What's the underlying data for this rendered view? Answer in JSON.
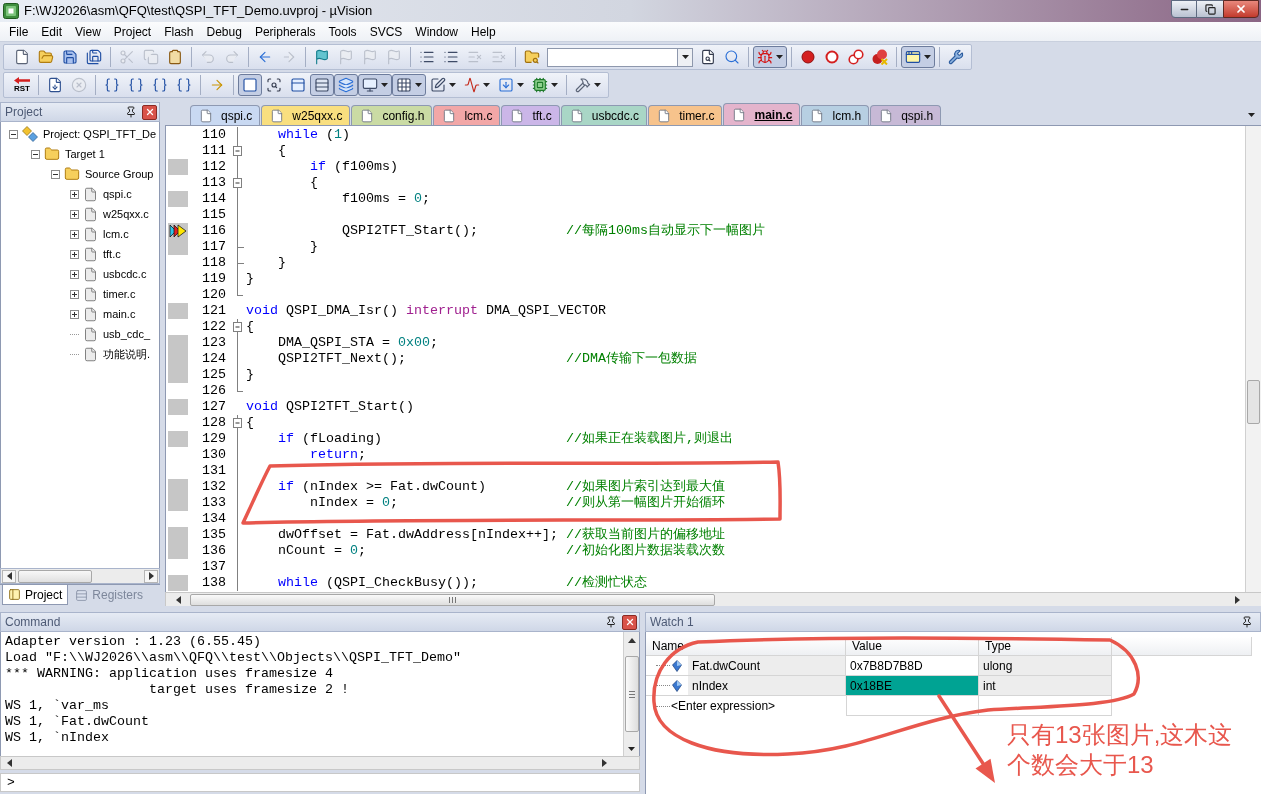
{
  "window": {
    "title": "F:\\WJ2026\\asm\\QFQ\\test\\QSPI_TFT_Demo.uvproj - µVision"
  },
  "menu": [
    "File",
    "Edit",
    "View",
    "Project",
    "Flash",
    "Debug",
    "Peripherals",
    "Tools",
    "SVCS",
    "Window",
    "Help"
  ],
  "toolbar_1": [
    {
      "kind": "button",
      "disabled": false,
      "pressed": false
    },
    {
      "kind": "button",
      "disabled": false,
      "pressed": false
    },
    {
      "kind": "button",
      "disabled": false,
      "pressed": false
    },
    {
      "kind": "button",
      "disabled": false,
      "pressed": false
    },
    {
      "kind": "separator"
    },
    {
      "kind": "button",
      "disabled": true,
      "pressed": false
    },
    {
      "kind": "button",
      "disabled": true,
      "pressed": false
    },
    {
      "kind": "button",
      "disabled": false,
      "pressed": false
    },
    {
      "kind": "separator"
    },
    {
      "kind": "button",
      "disabled": true,
      "pressed": false
    },
    {
      "kind": "button",
      "disabled": true,
      "pressed": false
    },
    {
      "kind": "separator"
    },
    {
      "kind": "button",
      "disabled": false,
      "pressed": false
    },
    {
      "kind": "button",
      "disabled": true,
      "pressed": false
    },
    {
      "kind": "separator"
    },
    {
      "kind": "button",
      "disabled": false,
      "pressed": false
    },
    {
      "kind": "button",
      "disabled": true,
      "pressed": false
    },
    {
      "kind": "button",
      "disabled": true,
      "pressed": false
    },
    {
      "kind": "button",
      "disabled": true,
      "pressed": false
    },
    {
      "kind": "separator"
    },
    {
      "kind": "button",
      "disabled": false,
      "pressed": false
    },
    {
      "kind": "button",
      "disabled": false,
      "pressed": false
    },
    {
      "kind": "button",
      "disabled": true,
      "pressed": false
    },
    {
      "kind": "button",
      "disabled": true,
      "pressed": false
    },
    {
      "kind": "separator"
    },
    {
      "kind": "button",
      "disabled": false,
      "pressed": false
    },
    {
      "kind": "combo"
    },
    {
      "kind": "button",
      "disabled": false,
      "pressed": false
    },
    {
      "kind": "button",
      "disabled": false,
      "pressed": false
    },
    {
      "kind": "separator"
    },
    {
      "kind": "button",
      "disabled": false,
      "pressed": true,
      "dropdown": true
    },
    {
      "kind": "separator"
    },
    {
      "kind": "button",
      "disabled": false,
      "pressed": false
    },
    {
      "kind": "button",
      "disabled": false,
      "pressed": false
    },
    {
      "kind": "button",
      "disabled": false,
      "pressed": false
    },
    {
      "kind": "button",
      "disabled": false,
      "pressed": false
    },
    {
      "kind": "separator"
    },
    {
      "kind": "button",
      "disabled": false,
      "pressed": true,
      "dropdown": true
    },
    {
      "kind": "separator"
    },
    {
      "kind": "button",
      "disabled": false,
      "pressed": false
    }
  ],
  "toolbar_2": [
    {
      "kind": "button",
      "label": "RST",
      "disabled": false,
      "pressed": false
    },
    {
      "kind": "separator"
    },
    {
      "kind": "button",
      "disabled": false,
      "pressed": false
    },
    {
      "kind": "button",
      "disabled": true,
      "pressed": false
    },
    {
      "kind": "separator"
    },
    {
      "kind": "button",
      "disabled": false,
      "pressed": false
    },
    {
      "kind": "button",
      "disabled": false,
      "pressed": false
    },
    {
      "kind": "button",
      "disabled": false,
      "pressed": false
    },
    {
      "kind": "button",
      "disabled": false,
      "pressed": false
    },
    {
      "kind": "separator"
    },
    {
      "kind": "button",
      "disabled": false,
      "pressed": false
    },
    {
      "kind": "separator"
    },
    {
      "kind": "button",
      "disabled": false,
      "pressed": true
    },
    {
      "kind": "button",
      "disabled": false,
      "pressed": false
    },
    {
      "kind": "button",
      "disabled": false,
      "pressed": false
    },
    {
      "kind": "button",
      "disabled": false,
      "pressed": true
    },
    {
      "kind": "button",
      "disabled": false,
      "pressed": true
    },
    {
      "kind": "button",
      "disabled": false,
      "pressed": true,
      "dropdown": true
    },
    {
      "kind": "button",
      "disabled": false,
      "pressed": true,
      "dropdown": true
    },
    {
      "kind": "button",
      "disabled": false,
      "pressed": false,
      "dropdown": true
    },
    {
      "kind": "button",
      "disabled": false,
      "pressed": false,
      "dropdown": true
    },
    {
      "kind": "button",
      "disabled": false,
      "pressed": false,
      "dropdown": true
    },
    {
      "kind": "button",
      "disabled": false,
      "pressed": false,
      "dropdown": true
    },
    {
      "kind": "separator"
    },
    {
      "kind": "button",
      "disabled": false,
      "pressed": false,
      "dropdown": true
    }
  ],
  "project_panel": {
    "title": "Project",
    "tree": [
      {
        "label": "Project: QSPI_TFT_De",
        "expanded": true,
        "children": [
          {
            "label": "Target 1",
            "expanded": true,
            "children": [
              {
                "label": "Source Group",
                "expanded": true,
                "children": [
                  {
                    "label": "qspi.c",
                    "expanded": false
                  },
                  {
                    "label": "w25qxx.c",
                    "expanded": false
                  },
                  {
                    "label": "lcm.c",
                    "expanded": false
                  },
                  {
                    "label": "tft.c",
                    "expanded": false
                  },
                  {
                    "label": "usbcdc.c",
                    "expanded": false
                  },
                  {
                    "label": "timer.c",
                    "expanded": false
                  },
                  {
                    "label": "main.c",
                    "expanded": false
                  },
                  {
                    "label": "usb_cdc_"
                  },
                  {
                    "label": "功能说明."
                  }
                ]
              }
            ]
          }
        ]
      }
    ],
    "tabs": [
      {
        "label": "Project",
        "selected": true
      },
      {
        "label": "Registers",
        "selected": false
      }
    ]
  },
  "editor": {
    "tabs": [
      {
        "label": "qspi.c",
        "color": "#c9d9f2",
        "selected": false
      },
      {
        "label": "w25qxx.c",
        "color": "#f9df7f",
        "selected": false
      },
      {
        "label": "config.h",
        "color": "#cadba4",
        "selected": false
      },
      {
        "label": "lcm.c",
        "color": "#f2a7a7",
        "selected": false
      },
      {
        "label": "tft.c",
        "color": "#cbb6e8",
        "selected": false
      },
      {
        "label": "usbcdc.c",
        "color": "#a9d6c6",
        "selected": false
      },
      {
        "label": "timer.c",
        "color": "#f7c38c",
        "selected": false
      },
      {
        "label": "main.c",
        "color": "#e4b4cc",
        "selected": true
      },
      {
        "label": "lcm.h",
        "color": "#b7cfe2",
        "selected": false
      },
      {
        "label": "qspi.h",
        "color": "#c7b9d6",
        "selected": false
      }
    ],
    "lines": [
      {
        "number": "110",
        "kind": "bar",
        "executable": false,
        "current": false,
        "tokens": [
          {
            "kind": "keyword",
            "text": "    while"
          },
          {
            "kind": "plain",
            "text": " ("
          },
          {
            "kind": "number",
            "text": "1"
          },
          {
            "kind": "plain",
            "text": ")"
          }
        ]
      },
      {
        "number": "111",
        "kind": "open",
        "executable": false,
        "current": false,
        "tokens": [
          {
            "kind": "plain",
            "text": "    {"
          }
        ]
      },
      {
        "number": "112",
        "kind": "bar",
        "executable": true,
        "current": false,
        "tokens": [
          {
            "kind": "keyword",
            "text": "        if"
          },
          {
            "kind": "plain",
            "text": " (f100ms)"
          }
        ]
      },
      {
        "number": "113",
        "kind": "open",
        "executable": false,
        "current": false,
        "tokens": [
          {
            "kind": "plain",
            "text": "        {"
          }
        ]
      },
      {
        "number": "114",
        "kind": "bar",
        "executable": true,
        "current": false,
        "tokens": [
          {
            "kind": "plain",
            "text": "            f100ms = "
          },
          {
            "kind": "number",
            "text": "0"
          },
          {
            "kind": "plain",
            "text": ";"
          }
        ]
      },
      {
        "number": "115",
        "kind": "bar",
        "executable": false,
        "current": false
      },
      {
        "number": "116",
        "kind": "bar",
        "executable": true,
        "current": true,
        "tokens": [
          {
            "kind": "plain",
            "text": "            QSPI2TFT_Start();           "
          },
          {
            "kind": "comment",
            "text": "//每隔100ms自动显示下一幅图片"
          }
        ]
      },
      {
        "number": "117",
        "kind": "tee",
        "executable": true,
        "current": false,
        "tokens": [
          {
            "kind": "plain",
            "text": "        }"
          }
        ]
      },
      {
        "number": "118",
        "kind": "tee",
        "executable": false,
        "current": false,
        "tokens": [
          {
            "kind": "plain",
            "text": "    }"
          }
        ]
      },
      {
        "number": "119",
        "kind": "bar",
        "executable": false,
        "current": false,
        "tokens": [
          {
            "kind": "plain",
            "text": "}"
          }
        ]
      },
      {
        "number": "120",
        "kind": "end",
        "executable": false,
        "current": false
      },
      {
        "number": "121",
        "kind": "plain",
        "executable": true,
        "current": false,
        "tokens": [
          {
            "kind": "keyword",
            "text": "void"
          },
          {
            "kind": "plain",
            "text": " QSPI_DMA_Isr() "
          },
          {
            "kind": "extended",
            "text": "interrupt"
          },
          {
            "kind": "plain",
            "text": " DMA_QSPI_VECTOR"
          }
        ]
      },
      {
        "number": "122",
        "kind": "open",
        "executable": false,
        "current": false,
        "tokens": [
          {
            "kind": "plain",
            "text": "{"
          }
        ]
      },
      {
        "number": "123",
        "kind": "bar",
        "executable": true,
        "current": false,
        "tokens": [
          {
            "kind": "plain",
            "text": "    DMA_QSPI_STA = "
          },
          {
            "kind": "number",
            "text": "0x00"
          },
          {
            "kind": "plain",
            "text": ";"
          }
        ]
      },
      {
        "number": "124",
        "kind": "bar",
        "executable": true,
        "current": false,
        "tokens": [
          {
            "kind": "plain",
            "text": "    QSPI2TFT_Next();                    "
          },
          {
            "kind": "comment",
            "text": "//DMA传输下一包数据"
          }
        ]
      },
      {
        "number": "125",
        "kind": "bar",
        "executable": true,
        "current": false,
        "tokens": [
          {
            "kind": "plain",
            "text": "}"
          }
        ]
      },
      {
        "number": "126",
        "kind": "end",
        "executable": false,
        "current": false
      },
      {
        "number": "127",
        "kind": "plain",
        "executable": true,
        "current": false,
        "tokens": [
          {
            "kind": "keyword",
            "text": "void"
          },
          {
            "kind": "plain",
            "text": " QSPI2TFT_Start()"
          }
        ]
      },
      {
        "number": "128",
        "kind": "open",
        "executable": false,
        "current": false,
        "tokens": [
          {
            "kind": "plain",
            "text": "{"
          }
        ]
      },
      {
        "number": "129",
        "kind": "bar",
        "executable": true,
        "current": false,
        "tokens": [
          {
            "kind": "keyword",
            "text": "    if"
          },
          {
            "kind": "plain",
            "text": " (fLoading)                       "
          },
          {
            "kind": "comment",
            "text": "//如果正在装载图片,则退出"
          }
        ]
      },
      {
        "number": "130",
        "kind": "bar",
        "executable": false,
        "current": false,
        "tokens": [
          {
            "kind": "keyword",
            "text": "        return"
          },
          {
            "kind": "plain",
            "text": ";"
          }
        ]
      },
      {
        "number": "131",
        "kind": "bar",
        "executable": false,
        "current": false
      },
      {
        "number": "132",
        "kind": "bar",
        "executable": true,
        "current": false,
        "tokens": [
          {
            "kind": "keyword",
            "text": "    if"
          },
          {
            "kind": "plain",
            "text": " (nIndex >= Fat.dwCount)          "
          },
          {
            "kind": "comment",
            "text": "//如果图片索引达到最大值"
          }
        ]
      },
      {
        "number": "133",
        "kind": "bar",
        "executable": true,
        "current": false,
        "tokens": [
          {
            "kind": "plain",
            "text": "        nIndex = "
          },
          {
            "kind": "number",
            "text": "0"
          },
          {
            "kind": "plain",
            "text": ";                     "
          },
          {
            "kind": "comment",
            "text": "//则从第一幅图片开始循环"
          }
        ]
      },
      {
        "number": "134",
        "kind": "bar",
        "executable": false,
        "current": false
      },
      {
        "number": "135",
        "kind": "bar",
        "executable": true,
        "current": false,
        "tokens": [
          {
            "kind": "plain",
            "text": "    dwOffset = Fat.dwAddress[nIndex++]; "
          },
          {
            "kind": "comment",
            "text": "//获取当前图片的偏移地址"
          }
        ]
      },
      {
        "number": "136",
        "kind": "bar",
        "executable": true,
        "current": false,
        "tokens": [
          {
            "kind": "plain",
            "text": "    nCount = "
          },
          {
            "kind": "number",
            "text": "0"
          },
          {
            "kind": "plain",
            "text": ";                         "
          },
          {
            "kind": "comment",
            "text": "//初始化图片数据装载次数"
          }
        ]
      },
      {
        "number": "137",
        "kind": "bar",
        "executable": false,
        "current": false
      },
      {
        "number": "138",
        "kind": "bar",
        "executable": true,
        "current": false,
        "tokens": [
          {
            "kind": "keyword",
            "text": "    while"
          },
          {
            "kind": "plain",
            "text": " (QSPI_CheckBusy());           "
          },
          {
            "kind": "comment",
            "text": "//检测忙状态"
          }
        ]
      }
    ]
  },
  "command": {
    "title": "Command",
    "lines": [
      "Adapter version : 1.23 (6.55.45)",
      "Load \"F:\\\\WJ2026\\\\asm\\\\QFQ\\\\test\\\\Objects\\\\QSPI_TFT_Demo\"",
      "*** WARNING: application uses framesize 4",
      "                  target uses framesize 2 !",
      "WS 1, `var_ms",
      "WS 1, `Fat.dwCount",
      "WS 1, `nIndex"
    ],
    "prompt": ">"
  },
  "watch": {
    "title": "Watch 1",
    "columns": [
      "Name",
      "Value",
      "Type"
    ],
    "rows": [
      {
        "name": "Fat.dwCount",
        "value": "0x7B8D7B8D",
        "type": "ulong",
        "changed": false
      },
      {
        "name": "nIndex",
        "value": "0x18BE",
        "type": "int",
        "changed": true
      }
    ],
    "entry": {
      "placeholder": "<Enter expression>"
    },
    "note": {
      "lines": [
        "只有13张图片,这木这",
        "个数会大于13"
      ]
    }
  }
}
